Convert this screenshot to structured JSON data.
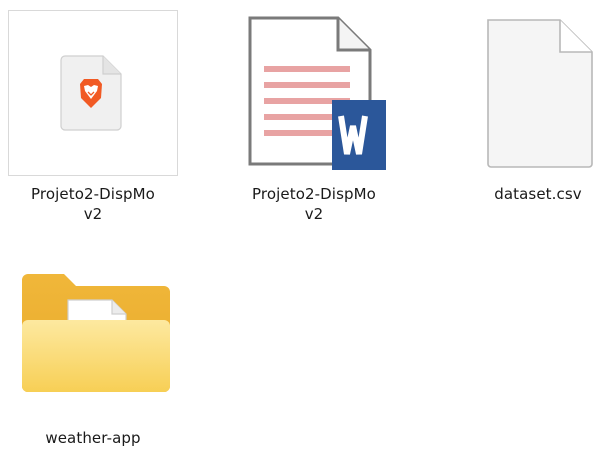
{
  "files": [
    {
      "type": "html-file",
      "icon": "brave-browser-file-icon",
      "name_line1": "Projeto2-DispMo",
      "name_line2": "v2"
    },
    {
      "type": "word-document",
      "icon": "word-document-icon",
      "name_line1": "Projeto2-DispMo",
      "name_line2": "v2"
    },
    {
      "type": "csv-file",
      "icon": "blank-file-icon",
      "name_line1": "dataset.csv",
      "name_line2": ""
    },
    {
      "type": "folder",
      "icon": "folder-icon",
      "name_line1": "weather-app",
      "name_line2": ""
    }
  ],
  "colors": {
    "brave_orange": "#f15a24",
    "word_blue": "#2b579a",
    "folder_yellow": "#f5c542",
    "doc_lines": "#e8a3a3"
  }
}
